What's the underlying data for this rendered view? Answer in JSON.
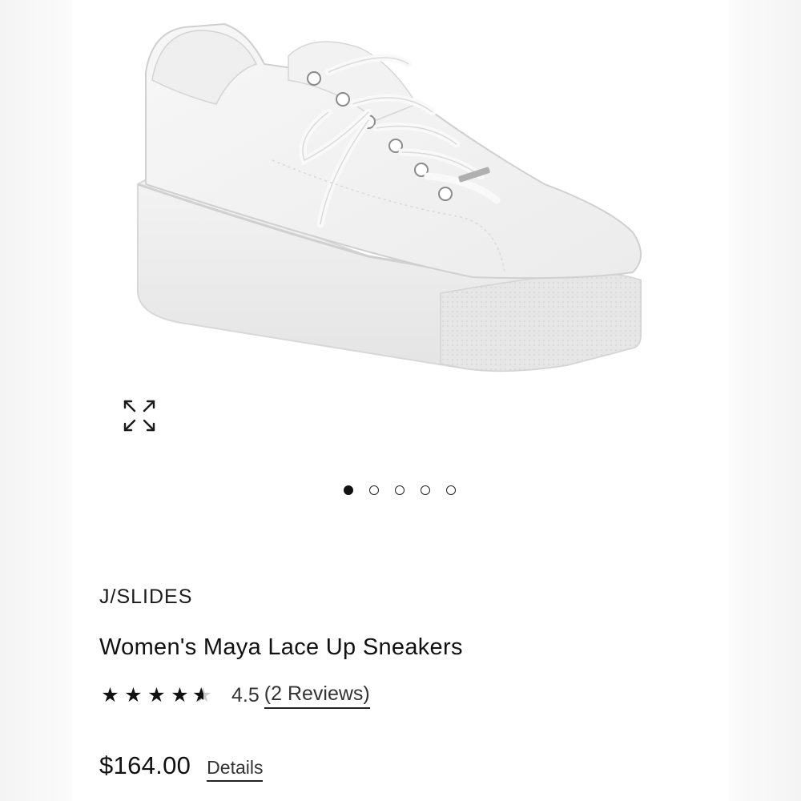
{
  "product": {
    "brand": "J/SLIDES",
    "name": "Women's Maya Lace Up Sneakers",
    "image_alt": "white leather platform sneaker"
  },
  "gallery": {
    "image_count": 5,
    "active_index": 0,
    "expand_icon": "expand-arrows-icon"
  },
  "rating": {
    "value": "4.5",
    "stars": 4.5,
    "reviews_label": "(2 Reviews)"
  },
  "pricing": {
    "price": "$164.00",
    "details_label": "Details"
  }
}
